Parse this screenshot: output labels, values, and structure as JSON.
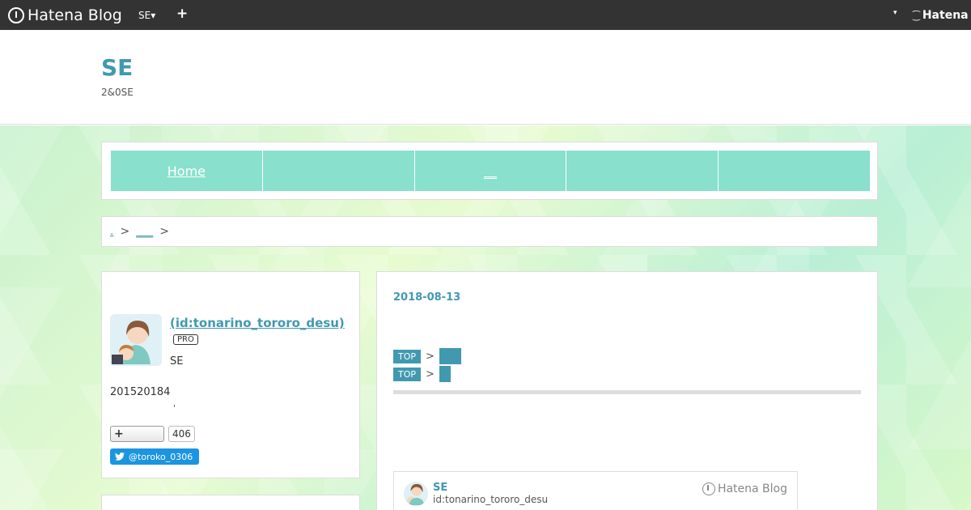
{
  "topbar": {
    "brand": "Hatena Blog",
    "blog_switch": "SE▾",
    "add": "+",
    "right_caret": "▾",
    "right_brand": "Hatena"
  },
  "header": {
    "title": "SE",
    "description": "2&0SE"
  },
  "global_nav": [
    {
      "label": "Home"
    },
    {
      "label": ""
    },
    {
      "label": "__"
    },
    {
      "label": ""
    },
    {
      "label": ""
    }
  ],
  "breadcrumb": {
    "first": ".",
    "sep1": ">",
    "second": "___",
    "sep2": ">"
  },
  "profile": {
    "name": " (id:tonarino_tororo_desu)",
    "pro_label": "PRO",
    "role": "SE",
    "date_text": "201520184",
    "mark": "'",
    "follow_icon": "+",
    "follow_count": "406",
    "twitter_handle": "@toroko_0306"
  },
  "entry": {
    "date": "2018-08-13",
    "category_rows": [
      {
        "top": "TOP",
        "sep": ">"
      },
      {
        "top": "TOP",
        "sep": ">"
      }
    ]
  },
  "embed_card": {
    "title": "SE",
    "id": "id:tonarino_tororo_desu",
    "brand": "Hatena Blog"
  },
  "colors": {
    "accent": "#4199b0",
    "nav_bg": "#88e0cd",
    "topbar": "#333333",
    "twitter": "#1b95e0"
  }
}
